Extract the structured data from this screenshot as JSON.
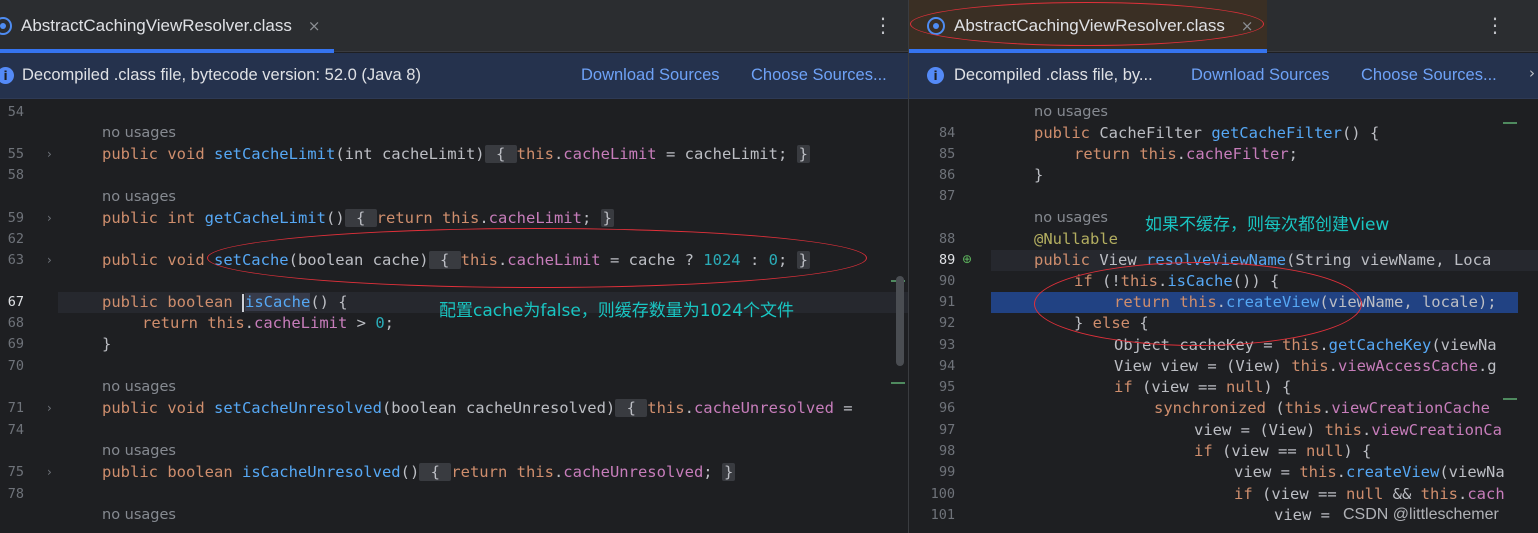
{
  "left": {
    "tab_title": "AbstractCachingViewResolver.class",
    "tab_close": "×",
    "banner_text": "Decompiled .class file, bytecode version: 52.0 (Java 8)",
    "download_sources": "Download Sources",
    "choose_sources": "Choose Sources...",
    "line_numbers": [
      "54",
      "55",
      "58",
      "59",
      "62",
      "63",
      "67",
      "68",
      "69",
      "70",
      "71",
      "74",
      "75",
      "78"
    ],
    "no_usages": "no usages",
    "code": {
      "l55": [
        "public void ",
        "setCacheLimit",
        "(int cacheLimit)",
        " { ",
        "this",
        ".",
        "cacheLimit",
        " = cacheLimit; ",
        "}"
      ],
      "l59": [
        "public int ",
        "getCacheLimit",
        "()",
        " { ",
        "return this",
        ".",
        "cacheLimit",
        "; ",
        "}"
      ],
      "l63": [
        "public void ",
        "setCache",
        "(boolean cache)",
        " { ",
        "this",
        ".",
        "cacheLimit",
        " = cache ? ",
        "1024",
        " : ",
        "0",
        "; ",
        "}"
      ],
      "l67": [
        "public boolean ",
        "isCache",
        "() {"
      ],
      "l68": [
        "return this",
        ".",
        "cacheLimit",
        " > ",
        "0",
        ";"
      ],
      "l69": "}",
      "l71": [
        "public void ",
        "setCacheUnresolved",
        "(boolean cacheUnresolved)",
        " { ",
        "this",
        ".",
        "cacheUnresolved",
        " ="
      ],
      "l75": [
        "public boolean ",
        "isCacheUnresolved",
        "()",
        " { ",
        "return this",
        ".",
        "cacheUnresolved",
        "; ",
        "}"
      ]
    },
    "annotation": "配置cache为false，则缓存数量为1024个文件"
  },
  "right": {
    "tab_title": "AbstractCachingViewResolver.class",
    "tab_close": "×",
    "banner_text": "Decompiled .class file, by...",
    "download_sources": "Download Sources",
    "choose_sources": "Choose Sources...",
    "line_numbers": [
      "84",
      "85",
      "86",
      "87",
      "88",
      "89",
      "90",
      "91",
      "92",
      "93",
      "94",
      "95",
      "96",
      "97",
      "98",
      "99",
      "100",
      "101"
    ],
    "no_usages": "no usages",
    "annotation": "如果不缓存，则每次都创建View",
    "code": {
      "l84": [
        "public ",
        "CacheFilter ",
        "getCacheFilter",
        "() {"
      ],
      "l85": [
        "return this",
        ".",
        "cacheFilter",
        ";"
      ],
      "l86": "}",
      "l88": "@Nullable",
      "l89": [
        "public ",
        "View ",
        "resolveViewName",
        "(String viewName, Loca"
      ],
      "l90": [
        "if ",
        "(!",
        "this",
        ".",
        "isCache",
        "()) {"
      ],
      "l91": [
        "return this",
        ".",
        "createView",
        "(viewName, locale);"
      ],
      "l92": [
        "} ",
        "else",
        " {"
      ],
      "l93": [
        "Object cacheKey = ",
        "this",
        ".",
        "getCacheKey",
        "(viewNa"
      ],
      "l94": [
        "View view = (View) ",
        "this",
        ".",
        "viewAccessCache",
        ".g"
      ],
      "l95": [
        "if ",
        "(view == ",
        "null",
        ") {"
      ],
      "l96": [
        "synchronized ",
        "(",
        "this",
        ".",
        "viewCreationCache"
      ],
      "l97": [
        "view = (View) ",
        "this",
        ".",
        "viewCreationCa"
      ],
      "l98": [
        "if ",
        "(view == ",
        "null",
        ") {"
      ],
      "l99": [
        "view = ",
        "this",
        ".",
        "createView",
        "(viewNa"
      ],
      "l100": [
        "if ",
        "(view == ",
        "null",
        " && ",
        "this",
        ".",
        "cach"
      ],
      "l101": [
        "view = "
      ]
    },
    "watermark": "CSDN @littleschemer",
    "edge_chevron": "›"
  },
  "colors": {
    "keyword": "#cf8e6d",
    "function": "#56a8f5",
    "field": "#c77dbb",
    "number": "#2aacb8",
    "annotation_text": "#19c5c2",
    "ellipse": "#e0303a",
    "link": "#6ea2f7"
  },
  "icons": [
    "class-file-icon",
    "info-icon",
    "kebab-menu-icon",
    "fold-chevron-icon",
    "override-gutter-icon"
  ]
}
